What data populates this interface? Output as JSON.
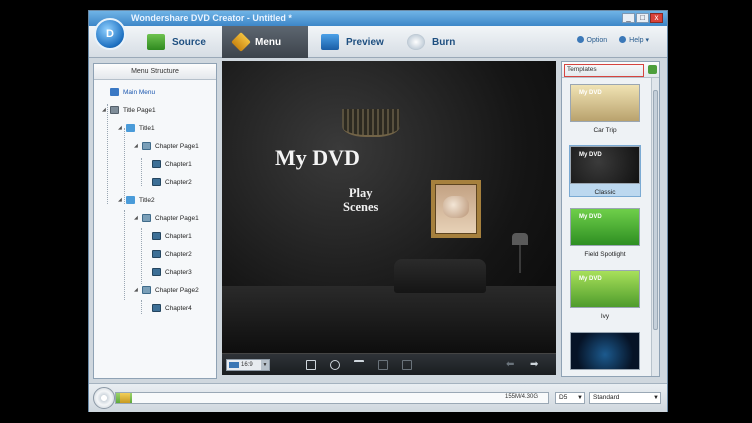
{
  "window": {
    "title": "Wondershare DVD Creator - Untitled *",
    "controls": [
      "_",
      "□",
      "x"
    ]
  },
  "toolbar": {
    "logo_text": "D",
    "tabs": [
      {
        "label": "Source",
        "icon": "source-icon"
      },
      {
        "label": "Menu",
        "icon": "menu-icon",
        "active": true
      },
      {
        "label": "Preview",
        "icon": "preview-icon"
      },
      {
        "label": "Burn",
        "icon": "burn-icon"
      }
    ],
    "option_label": "Option",
    "help_label": "Help ▾"
  },
  "menu_structure": {
    "header": "Menu Structure",
    "items": [
      {
        "label": "Main Menu",
        "level": 0
      },
      {
        "label": "Title Page1",
        "level": 0
      },
      {
        "label": "Title1",
        "level": 1
      },
      {
        "label": "Chapter Page1",
        "level": 2
      },
      {
        "label": "Chapter1",
        "level": 3
      },
      {
        "label": "Chapter2",
        "level": 3
      },
      {
        "label": "Title2",
        "level": 1
      },
      {
        "label": "Chapter Page1",
        "level": 2
      },
      {
        "label": "Chapter1",
        "level": 3
      },
      {
        "label": "Chapter2",
        "level": 3
      },
      {
        "label": "Chapter3",
        "level": 3
      },
      {
        "label": "Chapter Page2",
        "level": 2
      },
      {
        "label": "Chapter4",
        "level": 3
      }
    ]
  },
  "preview": {
    "title": "My DVD",
    "play_line1": "Play",
    "play_line2": "Scenes",
    "aspect_ratio": "16:9"
  },
  "templates": {
    "header": "Templates",
    "items": [
      {
        "name": "Car Trip",
        "thumb_text": "My DVD",
        "selected": false
      },
      {
        "name": "Classic",
        "thumb_text": "My DVD",
        "selected": true
      },
      {
        "name": "Field Spotlight",
        "thumb_text": "My DVD",
        "selected": false
      },
      {
        "name": "Ivy",
        "thumb_text": "My DVD",
        "selected": false
      },
      {
        "name": "",
        "thumb_text": "",
        "selected": false
      }
    ]
  },
  "status": {
    "capacity_text": "155M/4.30G",
    "disc_type": "D5",
    "quality": "Standard",
    "capacity_fraction": 0.036
  },
  "colors": {
    "accent": "#3d86c8",
    "active_tab": "#3c434b",
    "highlight": "#d6443f"
  }
}
